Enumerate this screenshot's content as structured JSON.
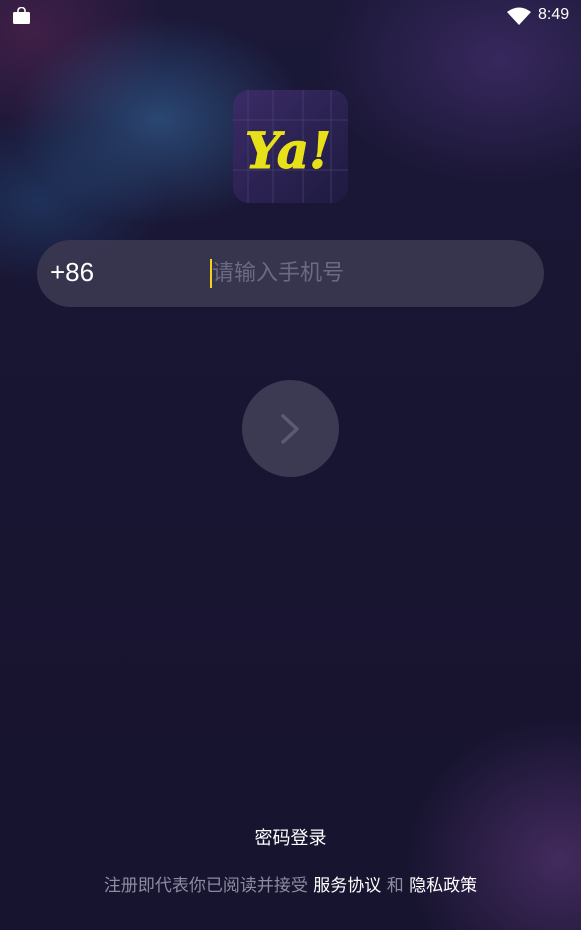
{
  "status_bar": {
    "time": "8:49",
    "left_icon": "shopping-bag-icon",
    "right_icons": [
      "wifi-icon"
    ]
  },
  "logo": {
    "text": "Ya!",
    "colors": {
      "text": "#e8e019",
      "background": "#2a2452"
    }
  },
  "login": {
    "country_code": "+86",
    "phone_placeholder": "请输入手机号",
    "phone_value": "",
    "next_icon": "chevron-right-icon",
    "password_login_label": "密码登录"
  },
  "agreement": {
    "prefix": "注册即代表你已阅读并接受",
    "terms_link": "服务协议",
    "conjunction": "和",
    "privacy_link": "隐私政策"
  },
  "colors": {
    "background": "#17142f",
    "field": "#3a3750",
    "caret": "#f3d21c",
    "secondary_text": "#8d8ba0"
  }
}
